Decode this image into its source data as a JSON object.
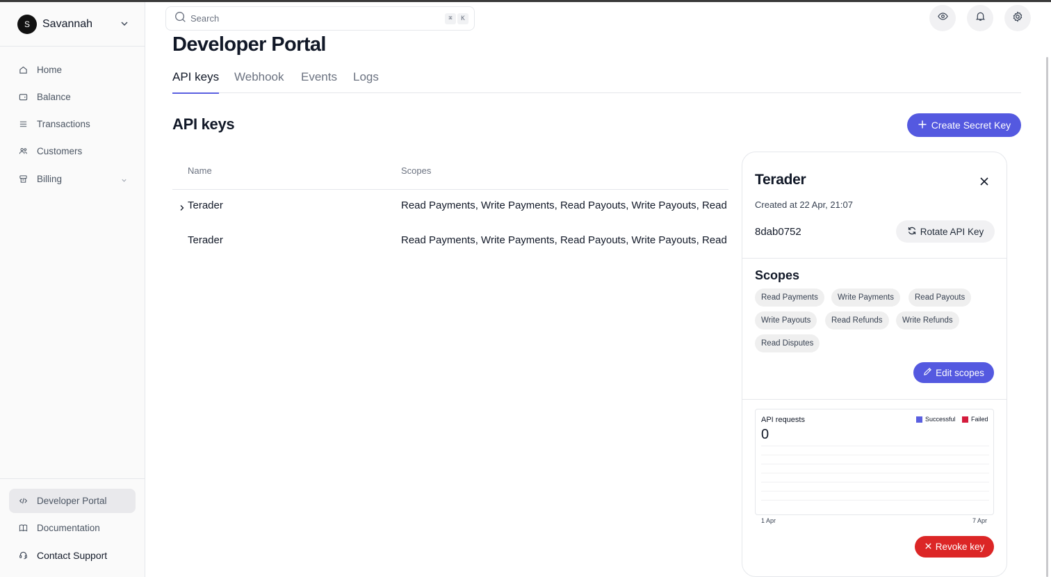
{
  "topbar": {
    "search_placeholder": "Search",
    "shortcut_keys": [
      "⌘",
      "K"
    ],
    "icons": [
      "eye-icon",
      "bell-icon",
      "gear-icon"
    ]
  },
  "sidebar": {
    "account": {
      "initial": "S",
      "name": "Savannah"
    },
    "items": [
      {
        "label": "Home",
        "icon": "home-icon"
      },
      {
        "label": "Balance",
        "icon": "wallet-icon"
      },
      {
        "label": "Transactions",
        "icon": "list-icon"
      },
      {
        "label": "Customers",
        "icon": "users-icon"
      },
      {
        "label": "Billing",
        "icon": "billing-icon",
        "has_submenu": true
      }
    ],
    "footer_items": [
      {
        "label": "Developer Portal",
        "icon": "code-icon",
        "active": true
      },
      {
        "label": "Documentation",
        "icon": "book-icon"
      },
      {
        "label": "Contact Support",
        "icon": "headset-icon"
      }
    ]
  },
  "page": {
    "title": "Developer Portal",
    "tabs": [
      {
        "label": "API keys",
        "active": true
      },
      {
        "label": "Webhook"
      },
      {
        "label": "Events"
      },
      {
        "label": "Logs"
      }
    ],
    "section_title": "API keys",
    "create_button": "Create Secret Key"
  },
  "table": {
    "columns": [
      "Name",
      "Scopes"
    ],
    "rows": [
      {
        "name": "Terader",
        "scopes": "Read Payments, Write Payments, Read Payouts, Write Payouts, Read Refunds, Write Refunds, Read Disputes",
        "expanded": true
      },
      {
        "name": "Terader",
        "scopes": "Read Payments, Write Payments, Read Payouts, Write Payouts, Read Refunds, Write Refunds, Read Disputes"
      }
    ]
  },
  "detail": {
    "title": "Terader",
    "created": "Created at 22 Apr, 21:07",
    "key_id": "8dab0752",
    "rotate_button": "Rotate API Key",
    "scopes_title": "Scopes",
    "scopes": [
      "Read Payments",
      "Write Payments",
      "Read Payouts",
      "Write Payouts",
      "Read Refunds",
      "Write Refunds",
      "Read Disputes"
    ],
    "edit_button": "Edit scopes",
    "revoke_button": "Revoke key"
  },
  "chart_data": {
    "type": "line",
    "title": "API requests",
    "total": "0",
    "x": [
      "1 Apr",
      "7 Apr"
    ],
    "series": [
      {
        "name": "Successful",
        "color": "#5a5fe0",
        "values": [
          0,
          0
        ]
      },
      {
        "name": "Failed",
        "color": "#d41b3c",
        "values": [
          0,
          0
        ]
      }
    ],
    "legend": "top-right",
    "grid": true
  },
  "colors": {
    "accent": "#5459e0",
    "danger": "#dc2626"
  }
}
